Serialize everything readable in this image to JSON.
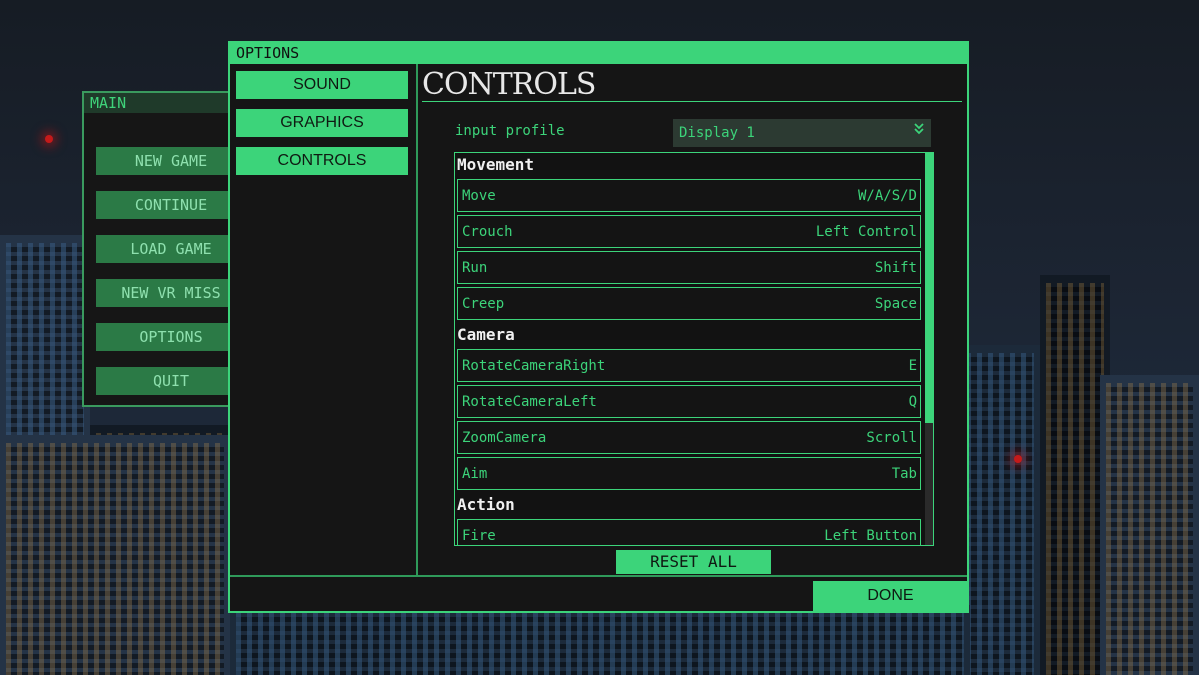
{
  "main_menu": {
    "title": "MAIN",
    "buttons": [
      "NEW GAME",
      "CONTINUE",
      "LOAD GAME",
      "NEW VR MISS",
      "OPTIONS",
      "QUIT"
    ]
  },
  "options": {
    "title": "OPTIONS",
    "tabs": [
      "SOUND",
      "GRAPHICS",
      "CONTROLS"
    ],
    "active_tab": "CONTROLS",
    "heading": "CONTROLS",
    "input_profile": {
      "label": "input profile",
      "value": "Display 1",
      "icon": "chevron-down-icon"
    },
    "sections": [
      {
        "name": "Movement",
        "bindings": [
          {
            "action": "Move",
            "key": "W/A/S/D"
          },
          {
            "action": "Crouch",
            "key": "Left Control"
          },
          {
            "action": "Run",
            "key": "Shift"
          },
          {
            "action": "Creep",
            "key": "Space"
          }
        ]
      },
      {
        "name": "Camera",
        "bindings": [
          {
            "action": "RotateCameraRight",
            "key": "E"
          },
          {
            "action": "RotateCameraLeft",
            "key": "Q"
          },
          {
            "action": "ZoomCamera",
            "key": "Scroll"
          },
          {
            "action": "Aim",
            "key": "Tab"
          }
        ]
      },
      {
        "name": "Action",
        "bindings": [
          {
            "action": "Fire",
            "key": "Left Button"
          }
        ]
      }
    ],
    "reset_label": "RESET ALL",
    "done_label": "DONE"
  },
  "colors": {
    "accent": "#3cd47a",
    "panel": "#151515",
    "muted_green": "#2b7a46"
  }
}
